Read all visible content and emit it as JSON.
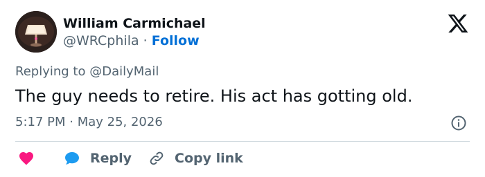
{
  "author": {
    "name": "William Carmichael",
    "handle": "@WRCphila",
    "separator": "·",
    "follow_label": "Follow"
  },
  "reply_context": {
    "prefix": "Replying to",
    "mention": "@DailyMail"
  },
  "tweet": {
    "text": "The guy needs to retire. His act has gotting old.",
    "timestamp": "5:17 PM · May 25, 2026"
  },
  "actions": {
    "reply_label": "Reply",
    "copy_link_label": "Copy link"
  },
  "icons": {
    "logo": "x-logo-icon",
    "info": "info-icon",
    "like": "heart-icon",
    "reply": "speech-bubble-icon",
    "copy": "link-icon"
  },
  "colors": {
    "follow": "#006fd6",
    "secondary_text": "#536471",
    "heart": "#f91880",
    "reply_bubble": "#1d9bf0",
    "divider": "#cfd9de"
  }
}
